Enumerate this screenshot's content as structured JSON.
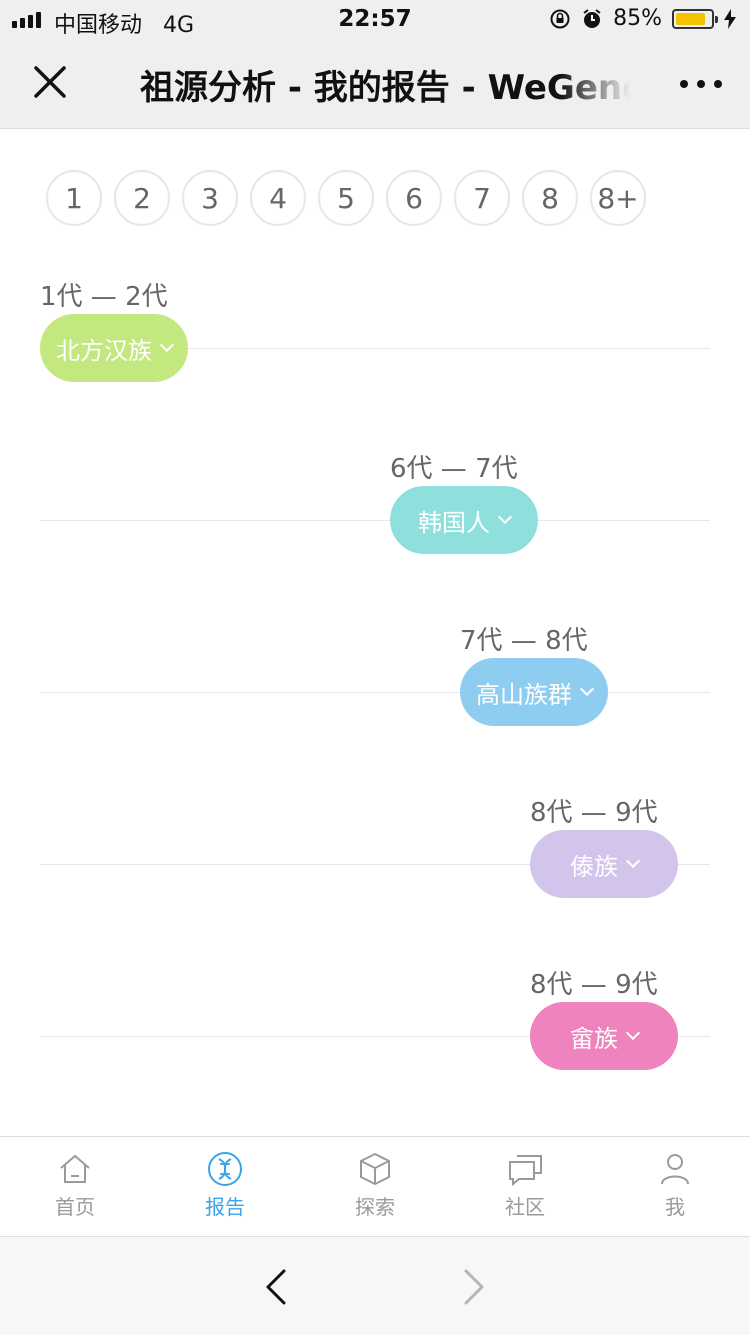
{
  "status_bar": {
    "carrier": "中国移动",
    "network": "4G",
    "time": "22:57",
    "battery_percent": "85%",
    "battery_level": 0.85
  },
  "nav": {
    "title": "祖源分析 - 我的报告 - WeGene",
    "close_icon": "close-icon",
    "more_icon": "more-icon"
  },
  "generation_tabs": [
    "1",
    "2",
    "3",
    "4",
    "5",
    "6",
    "7",
    "8",
    "8+"
  ],
  "ancestry_rows": [
    {
      "range": "1代 — 2代",
      "label": "北方汉族",
      "color": "#c2e87f"
    },
    {
      "range": "6代 — 7代",
      "label": "韩国人",
      "color": "#8fdfdc"
    },
    {
      "range": "7代 — 8代",
      "label": "高山族群",
      "color": "#8fcdf0"
    },
    {
      "range": "8代 — 9代",
      "label": "傣族",
      "color": "#d3c4ec"
    },
    {
      "range": "8代 — 9代",
      "label": "畲族",
      "color": "#ee83bd"
    }
  ],
  "tab_bar": {
    "items": [
      {
        "label": "首页",
        "icon": "home-icon",
        "active": false
      },
      {
        "label": "报告",
        "icon": "dna-icon",
        "active": true
      },
      {
        "label": "探索",
        "icon": "cube-icon",
        "active": false
      },
      {
        "label": "社区",
        "icon": "chat-icon",
        "active": false
      },
      {
        "label": "我",
        "icon": "user-icon",
        "active": false
      }
    ],
    "active_color": "#3aa4e8",
    "inactive_color": "#9a9a9a"
  },
  "browser_bar": {
    "back_icon": "back-arrow-icon",
    "forward_icon": "forward-arrow-icon"
  }
}
